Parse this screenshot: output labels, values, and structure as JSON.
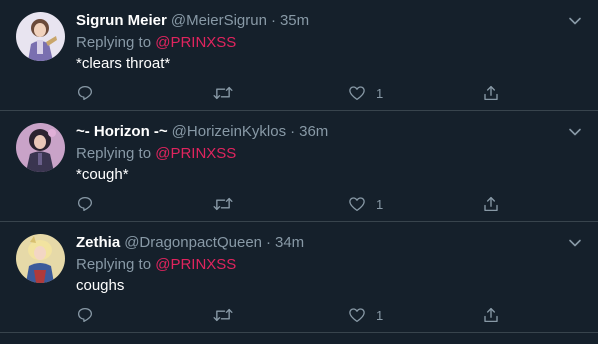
{
  "theme": {
    "background": "#15202b",
    "divider": "#38444d",
    "muted_text": "#8899a6",
    "mention_color": "#e0245e",
    "primary_text": "#ffffff"
  },
  "tweets": [
    {
      "display_name": "Sigrun Meier",
      "handle": "@MeierSigrun",
      "separator": "·",
      "time": "35m",
      "replying_prefix": "Replying to",
      "replying_to": "@PRINXSS",
      "text": "*clears throat*",
      "like_count": "1",
      "avatar": "anime-character-avatar",
      "icons": [
        "reply-icon",
        "retweet-icon",
        "like-icon",
        "share-icon",
        "chevron-down-icon"
      ]
    },
    {
      "display_name": "~- Horizon -~",
      "handle": "@HorizeinKyklos",
      "separator": "·",
      "time": "36m",
      "replying_prefix": "Replying to",
      "replying_to": "@PRINXSS",
      "text": "*cough*",
      "like_count": "1",
      "avatar": "anime-character-avatar",
      "icons": [
        "reply-icon",
        "retweet-icon",
        "like-icon",
        "share-icon",
        "chevron-down-icon"
      ]
    },
    {
      "display_name": "Zethia",
      "handle": "@DragonpactQueen",
      "separator": "·",
      "time": "34m",
      "replying_prefix": "Replying to",
      "replying_to": "@PRINXSS",
      "text": "coughs",
      "like_count": "1",
      "avatar": "anime-character-avatar",
      "icons": [
        "reply-icon",
        "retweet-icon",
        "like-icon",
        "share-icon",
        "chevron-down-icon"
      ]
    }
  ]
}
